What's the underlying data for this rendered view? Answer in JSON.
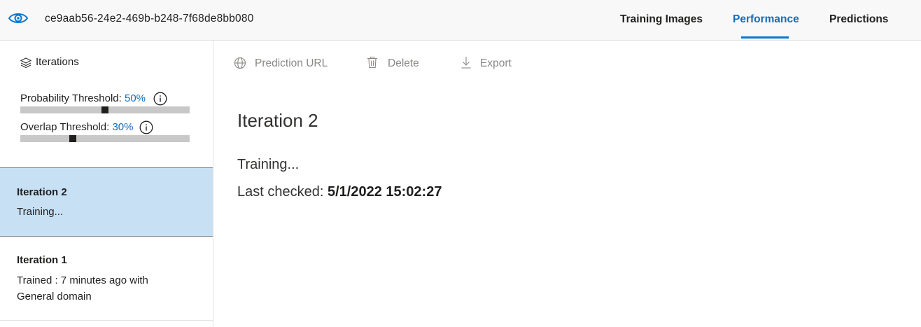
{
  "header": {
    "project_id": "ce9aab56-24e2-469b-b248-7f68de8bb080",
    "tabs": [
      {
        "label": "Training Images",
        "active": false
      },
      {
        "label": "Performance",
        "active": true
      },
      {
        "label": "Predictions",
        "active": false
      }
    ],
    "accent_color": "#0078d4"
  },
  "sidebar": {
    "iterations_label": "Iterations",
    "probability_threshold": {
      "label": "Probability Threshold:",
      "value": "50%",
      "fraction": 0.5
    },
    "overlap_threshold": {
      "label": "Overlap Threshold:",
      "value": "30%",
      "fraction": 0.3
    },
    "items": [
      {
        "name": "Iteration 2",
        "status": "Training...",
        "selected": true
      },
      {
        "name": "Iteration 1",
        "status": "Trained : 7 minutes ago with General domain",
        "selected": false
      }
    ]
  },
  "toolbar": {
    "prediction_url": "Prediction URL",
    "delete": "Delete",
    "export": "Export"
  },
  "main": {
    "title": "Iteration 2",
    "status": "Training...",
    "last_checked_label": "Last checked:",
    "last_checked_value": "5/1/2022 15:02:27"
  }
}
